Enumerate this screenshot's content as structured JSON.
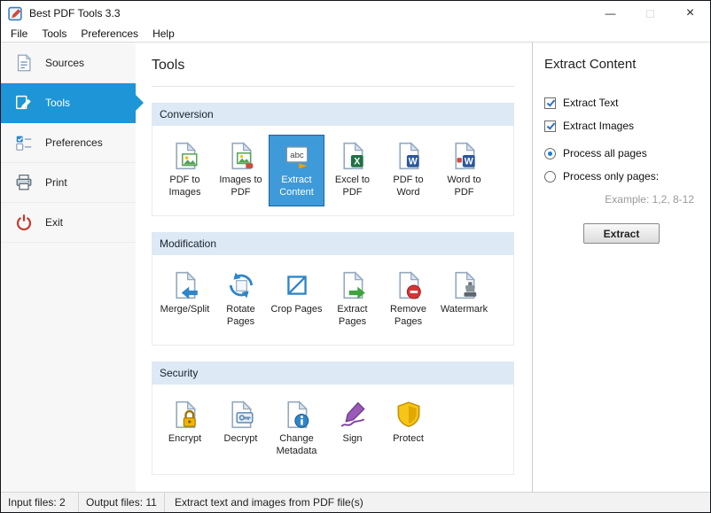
{
  "window": {
    "title": "Best PDF Tools 3.3",
    "controls": {
      "minimize": "—",
      "maximize": "□",
      "close": "×"
    }
  },
  "menu": {
    "items": [
      "File",
      "Tools",
      "Preferences",
      "Help"
    ]
  },
  "sidebar": {
    "items": [
      {
        "label": "Sources",
        "icon": "sources-icon",
        "selected": false
      },
      {
        "label": "Tools",
        "icon": "tools-icon",
        "selected": true
      },
      {
        "label": "Preferences",
        "icon": "preferences-icon",
        "selected": false
      },
      {
        "label": "Print",
        "icon": "printer-icon",
        "selected": false
      },
      {
        "label": "Exit",
        "icon": "power-icon",
        "selected": false
      }
    ]
  },
  "main": {
    "title": "Tools",
    "sections": [
      {
        "label": "Conversion",
        "tools": [
          {
            "label": "PDF to Images",
            "icon": "pdf-to-images-icon",
            "selected": false
          },
          {
            "label": "Images to PDF",
            "icon": "images-to-pdf-icon",
            "selected": false
          },
          {
            "label": "Extract Content",
            "icon": "extract-content-icon",
            "selected": true
          },
          {
            "label": "Excel to PDF",
            "icon": "excel-to-pdf-icon",
            "selected": false
          },
          {
            "label": "PDF to Word",
            "icon": "pdf-to-word-icon",
            "selected": false
          },
          {
            "label": "Word to PDF",
            "icon": "word-to-pdf-icon",
            "selected": false
          }
        ]
      },
      {
        "label": "Modification",
        "tools": [
          {
            "label": "Merge/Split",
            "icon": "merge-split-icon",
            "selected": false
          },
          {
            "label": "Rotate Pages",
            "icon": "rotate-pages-icon",
            "selected": false
          },
          {
            "label": "Crop Pages",
            "icon": "crop-pages-icon",
            "selected": false
          },
          {
            "label": "Extract Pages",
            "icon": "extract-pages-icon",
            "selected": false
          },
          {
            "label": "Remove Pages",
            "icon": "remove-pages-icon",
            "selected": false
          },
          {
            "label": "Watermark",
            "icon": "watermark-icon",
            "selected": false
          }
        ]
      },
      {
        "label": "Security",
        "tools": [
          {
            "label": "Encrypt",
            "icon": "encrypt-icon",
            "selected": false
          },
          {
            "label": "Decrypt",
            "icon": "decrypt-icon",
            "selected": false
          },
          {
            "label": "Change Metadata",
            "icon": "change-metadata-icon",
            "selected": false
          },
          {
            "label": "Sign",
            "icon": "sign-icon",
            "selected": false
          },
          {
            "label": "Protect",
            "icon": "protect-icon",
            "selected": false
          }
        ]
      }
    ]
  },
  "panel": {
    "title": "Extract Content",
    "options": [
      {
        "label": "Extract Text",
        "type": "checkbox",
        "checked": true
      },
      {
        "label": "Extract Images",
        "type": "checkbox",
        "checked": true
      },
      {
        "label": "Process all pages",
        "type": "radio",
        "selected": true
      },
      {
        "label": "Process only pages:",
        "type": "radio",
        "selected": false
      }
    ],
    "pages_hint": "Example: 1,2, 8-12",
    "extract_button": "Extract"
  },
  "statusbar": {
    "input_files": "Input files: 2",
    "output_files": "Output files: 11",
    "message": "Extract text and images from PDF file(s)"
  },
  "colors": {
    "accent_blue": "#1d95d6",
    "tool_selected_bg": "#3e9ad8",
    "section_header_bg": "#dde9f5"
  }
}
